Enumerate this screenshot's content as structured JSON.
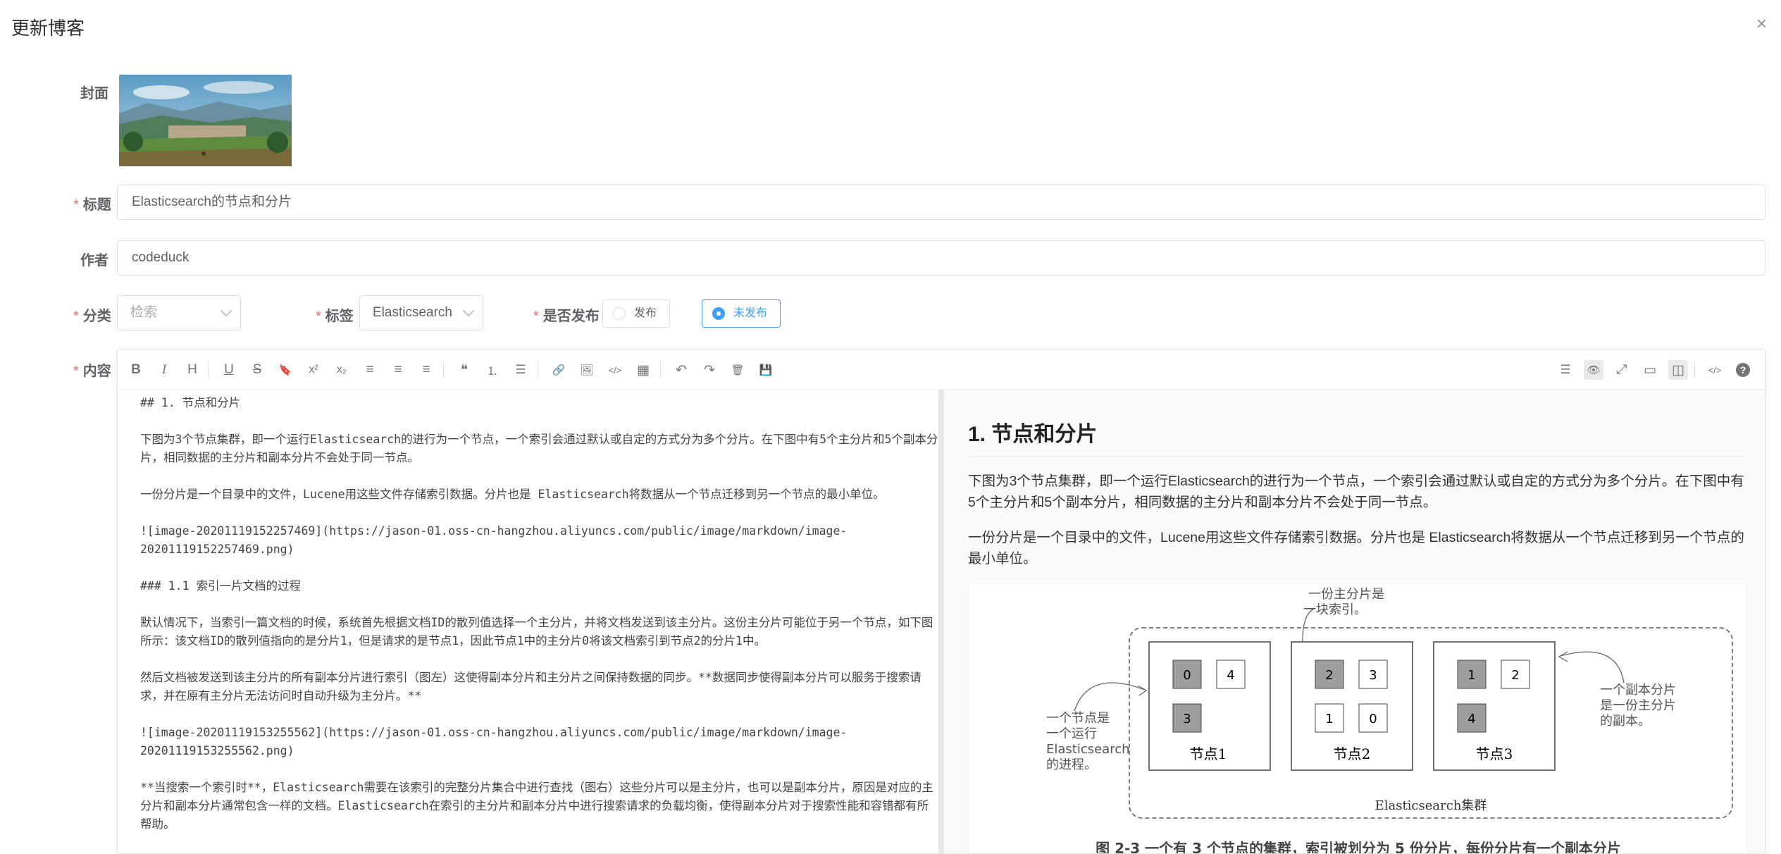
{
  "dialog": {
    "title": "更新博客",
    "close": "×"
  },
  "labels": {
    "cover": "封面",
    "title": "标题",
    "author": "作者",
    "category": "分类",
    "tag": "标签",
    "publish": "是否发布",
    "content": "内容"
  },
  "required_mark": "*",
  "fields": {
    "title_value": "Elasticsearch的节点和分片",
    "author_value": "codeduck",
    "category_placeholder": "检索",
    "tag_value": "Elasticsearch"
  },
  "publish_options": [
    {
      "label": "发布",
      "checked": false
    },
    {
      "label": "未发布",
      "checked": true
    }
  ],
  "toolbar_left": [
    {
      "name": "bold-icon",
      "glyph": "B"
    },
    {
      "name": "italic-icon",
      "glyph": "I"
    },
    {
      "name": "heading-icon",
      "glyph": "H"
    },
    {
      "name": "underline-icon",
      "glyph": "U"
    },
    {
      "name": "strikethrough-icon",
      "glyph": "S"
    },
    {
      "name": "mark-icon",
      "glyph": "🔖"
    },
    {
      "name": "superscript-icon",
      "glyph": "x²"
    },
    {
      "name": "subscript-icon",
      "glyph": "x₂"
    },
    {
      "name": "align-left-icon",
      "glyph": "≡"
    },
    {
      "name": "align-center-icon",
      "glyph": "≡"
    },
    {
      "name": "align-right-icon",
      "glyph": "≡"
    },
    {
      "name": "quote-icon",
      "glyph": "❝"
    },
    {
      "name": "ordered-list-icon",
      "glyph": "⒈"
    },
    {
      "name": "unordered-list-icon",
      "glyph": "☰"
    },
    {
      "name": "link-icon",
      "glyph": "🔗"
    },
    {
      "name": "image-icon",
      "glyph": "🖼"
    },
    {
      "name": "code-icon",
      "glyph": "</>"
    },
    {
      "name": "table-icon",
      "glyph": "▦"
    },
    {
      "name": "undo-icon",
      "glyph": "↶"
    },
    {
      "name": "redo-icon",
      "glyph": "↷"
    },
    {
      "name": "trash-icon",
      "glyph": "🗑"
    },
    {
      "name": "save-icon",
      "glyph": "💾"
    }
  ],
  "toolbar_right": [
    {
      "name": "navigation-icon",
      "glyph": "☰"
    },
    {
      "name": "preview-toggle-icon",
      "glyph": "👁"
    },
    {
      "name": "fullscreen-icon",
      "glyph": "⤢"
    },
    {
      "name": "read-mode-icon",
      "glyph": "▭"
    },
    {
      "name": "split-view-icon",
      "glyph": "◫"
    },
    {
      "name": "html-code-icon",
      "glyph": "</>"
    },
    {
      "name": "help-icon",
      "glyph": "?"
    }
  ],
  "source": [
    "## 1. 节点和分片",
    "下图为3个节点集群，即一个运行Elasticsearch的进行为一个节点，一个索引会通过默认或自定的方式分为多个分片。在下图中有5个主分片和5个副本分片，相同数据的主分片和副本分片不会处于同一节点。",
    "一份分片是一个目录中的文件，Lucene用这些文件存储索引数据。分片也是 Elasticsearch将数据从一个节点迁移到另一个节点的最小单位。",
    "![image-20201119152257469](https://jason-01.oss-cn-hangzhou.aliyuncs.com/public/image/markdown/image-20201119152257469.png)",
    "### 1.1 索引一片文档的过程",
    "默认情况下，当索引一篇文档的时候，系统首先根据文档ID的散列值选择一个主分片，并将文档发送到该主分片。这份主分片可能位于另一个节点，如下图所示：该文档ID的散列值指向的是分片1，但是请求的是节点1，因此节点1中的主分片0将该文档索引到节点2的分片1中。",
    "然后文档被发送到该主分片的所有副本分片进行索引（图左）这使得副本分片和主分片之间保持数据的同步。**数据同步使得副本分片可以服务于搜索请求，并在原有主分片无法访问时自动升级为主分片。**",
    "![image-20201119153255562](https://jason-01.oss-cn-hangzhou.aliyuncs.com/public/image/markdown/image-20201119153255562.png)",
    "**当搜索一个索引时**，Elasticsearch需要在该索引的完整分片集合中进行查找（图右）这些分片可以是主分片，也可以是副本分片，原因是对应的主分片和副本分片通常包含一样的文档。Elasticsearch在索引的主分片和副本分片中进行搜索请求的负载均衡，使得副本分片对于搜索性能和容错都有所帮助。"
  ],
  "preview": {
    "h1": "1. 节点和分片",
    "p1": "下图为3个节点集群，即一个运行Elasticsearch的进行为一个节点，一个索引会通过默认或自定的方式分为多个分片。在下图中有5个主分片和5个副本分片，相同数据的主分片和副本分片不会处于同一节点。",
    "p2": "一份分片是一个目录中的文件，Lucene用这些文件存储索引数据。分片也是 Elasticsearch将数据从一个节点迁移到另一个节点的最小单位。",
    "figure": {
      "annotation_top": [
        "一份主分片是",
        "一块索引。"
      ],
      "annotation_left": [
        "一个节点是",
        "一个运行",
        "Elasticsearch",
        "的进程。"
      ],
      "annotation_right": [
        "一个副本分片",
        "是一份主分片",
        "的副本。"
      ],
      "nodes": [
        {
          "name": "节点1",
          "shards": [
            {
              "id": "0",
              "primary": true
            },
            {
              "id": "4",
              "primary": false
            },
            {
              "id": "3",
              "primary": true
            }
          ]
        },
        {
          "name": "节点2",
          "shards": [
            {
              "id": "2",
              "primary": true
            },
            {
              "id": "3",
              "primary": false
            },
            {
              "id": "1",
              "primary": false
            },
            {
              "id": "0",
              "primary": false
            }
          ]
        },
        {
          "name": "节点3",
          "shards": [
            {
              "id": "1",
              "primary": true
            },
            {
              "id": "2",
              "primary": false
            },
            {
              "id": "4",
              "primary": true
            }
          ]
        }
      ],
      "cluster_label": "Elasticsearch集群",
      "caption": "图 2-3    一个有 3 个节点的集群，索引被划分为 5 份分片，每份分片有一个副本分片"
    }
  },
  "colors": {
    "required": "#f56c6c",
    "accent": "#409eff",
    "shard_primary": "#9e9e9e"
  }
}
